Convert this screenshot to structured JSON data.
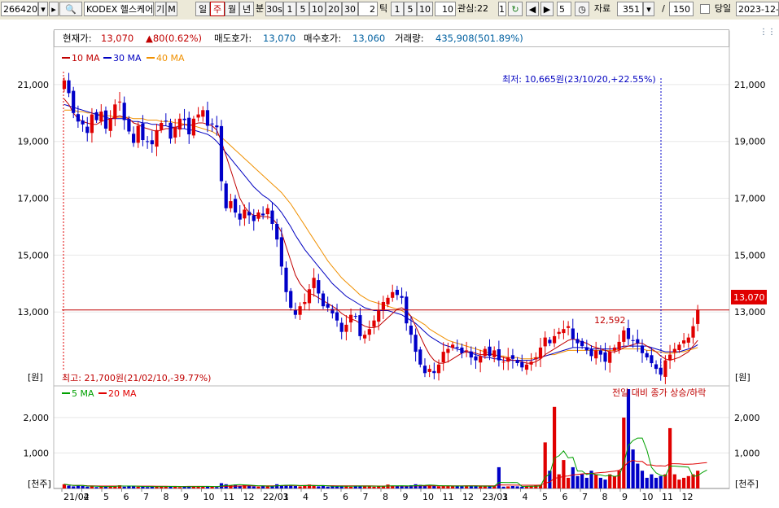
{
  "toolbar": {
    "code": "266420",
    "name": "KODEX 헬스케어",
    "btn_gi": "기",
    "btn_m": "M",
    "period_day": "일",
    "period_week": "주",
    "period_month": "월",
    "period_year": "년",
    "period_min": "분",
    "p30s": "30s",
    "p1": "1",
    "p5": "5",
    "p10": "10",
    "p20": "20",
    "p30": "30",
    "tick_value": "2",
    "tick_label": "틱",
    "t1": "1",
    "t5": "5",
    "t10": "10",
    "t10b": "10",
    "interest_label": "관심:22",
    "interest_num": "1",
    "step_value": "5",
    "data_label": "자료",
    "data_count": "351",
    "slash": "/",
    "view_count": "150",
    "today_label": "당일",
    "date": "2023-12-2"
  },
  "infobar": {
    "price_label": "현재가:",
    "price": "13,070",
    "change": "▲80(0.62%)",
    "ask_label": "매도호가:",
    "ask": "13,070",
    "bid_label": "매수호가:",
    "bid": "13,060",
    "volume_label": "거래량:",
    "volume": "435,908(501.89%)"
  },
  "labels": {
    "unit_price_left": "[원]",
    "unit_price_right": "[원]",
    "unit_vol_left": "[천주]",
    "unit_vol_right": "[천주]",
    "vol_note": "전일 대비 종가 상승/하락",
    "annot_low": "최저: 10,665원(23/10/20,+22.55%)",
    "annot_high": "최고: 21,700원(21/02/10,-39.77%)",
    "annot_mid": "12,592",
    "current_tag": "13,070"
  },
  "colors": {
    "up": "#e00000",
    "down": "#0000c8",
    "ma10": "#c00000",
    "ma30": "#0000c0",
    "ma40": "#f09000",
    "vma5": "#00a000",
    "vma20": "#e00000",
    "current_line": "#c00000",
    "grid": "#e8e8e8"
  },
  "chart_data": [
    {
      "type": "candlestick",
      "title": "",
      "legend": [
        "10 MA",
        "30 MA",
        "40 MA"
      ],
      "y_ticks": [
        "21,000",
        "19,000",
        "17,000",
        "15,000",
        "13,000"
      ],
      "ylim": [
        10400,
        22200
      ],
      "current": 13070,
      "x_ticks": [
        "21/02",
        "4",
        "5",
        "6",
        "7",
        "8",
        "9",
        "10",
        "11",
        "12",
        "22/01",
        "3",
        "4",
        "5",
        "6",
        "7",
        "8",
        "9",
        "10",
        "11",
        "12",
        "23/01",
        "3",
        "4",
        "5",
        "6",
        "7",
        "8",
        "9",
        "10",
        "11",
        "12"
      ],
      "closes": [
        21150,
        20700,
        20000,
        19700,
        19600,
        19300,
        19950,
        19750,
        20050,
        19450,
        19800,
        20300,
        20400,
        19750,
        19350,
        18950,
        19550,
        19050,
        19000,
        18900,
        19400,
        19650,
        19700,
        19100,
        19500,
        19800,
        19750,
        19250,
        19800,
        19950,
        20100,
        19550,
        19600,
        19500,
        17600,
        16650,
        16900,
        16500,
        16250,
        16600,
        16400,
        16200,
        16500,
        16400,
        16650,
        16100,
        15550,
        14600,
        13700,
        13150,
        12900,
        13200,
        13350,
        13800,
        14200,
        13650,
        13200,
        13150,
        12950,
        12700,
        12300,
        12550,
        12900,
        12850,
        12150,
        12200,
        12400,
        12700,
        13050,
        13350,
        13500,
        13700,
        13600,
        13500,
        12600,
        12200,
        11600,
        11150,
        10850,
        11000,
        10850,
        11150,
        11600,
        11700,
        11850,
        11750,
        11550,
        11650,
        11400,
        11300,
        11450,
        11700,
        11450,
        11650,
        11300,
        11250,
        11400,
        11350,
        11200,
        11050,
        11150,
        11250,
        11400,
        11750,
        12100,
        11900,
        12150,
        12300,
        12400,
        12500,
        12050,
        11900,
        11800,
        11650,
        11450,
        11650,
        11500,
        11250,
        11600,
        11750,
        11950,
        12350,
        12050,
        12000,
        11900,
        11550,
        11400,
        11200,
        11000,
        10800,
        11300,
        11500,
        11700,
        11850,
        12000,
        12100,
        12500,
        13070
      ],
      "ma10": [
        20500,
        20300,
        20000,
        19800,
        19700,
        19650,
        19600,
        19600,
        19700,
        19750,
        19800,
        19850,
        19900,
        19850,
        19800,
        19650,
        19600,
        19500,
        19450,
        19400,
        19350,
        19400,
        19450,
        19450,
        19500,
        19550,
        19600,
        19550,
        19600,
        19650,
        19650,
        19600,
        19550,
        19400,
        19000,
        18500,
        18000,
        17500,
        17000,
        16700,
        16500,
        16400,
        16400,
        16350,
        16350,
        16300,
        16100,
        15800,
        15300,
        14800,
        14300,
        14000,
        13800,
        13650,
        13600,
        13500,
        13400,
        13300,
        13200,
        13100,
        12950,
        12850,
        12750,
        12700,
        12600,
        12500,
        12450,
        12450,
        12500,
        12650,
        12800,
        12950,
        13100,
        13150,
        13050,
        12850,
        12500,
        12150,
        11800,
        11500,
        11300,
        11200,
        11200,
        11250,
        11350,
        11450,
        11550,
        11600,
        11600,
        11550,
        11500,
        11500,
        11500,
        11500,
        11450,
        11400,
        11350,
        11300,
        11300,
        11250,
        11200,
        11200,
        11250,
        11350,
        11500,
        11600,
        11700,
        11800,
        11900,
        12000,
        12050,
        12000,
        11950,
        11900,
        11800,
        11750,
        11700,
        11650,
        11600,
        11600,
        11650,
        11750,
        11800,
        11850,
        11900,
        11900,
        11800,
        11700,
        11600,
        11450,
        11350,
        11300,
        11350,
        11400,
        11500,
        11600,
        11800,
        12000
      ],
      "ma30": [
        20300,
        20250,
        20200,
        20150,
        20100,
        20050,
        20000,
        19950,
        19900,
        19850,
        19800,
        19800,
        19800,
        19800,
        19750,
        19700,
        19700,
        19650,
        19650,
        19600,
        19600,
        19550,
        19550,
        19500,
        19500,
        19450,
        19450,
        19400,
        19400,
        19350,
        19300,
        19250,
        19150,
        19000,
        18800,
        18600,
        18400,
        18200,
        18000,
        17800,
        17600,
        17400,
        17250,
        17100,
        17000,
        16850,
        16700,
        16500,
        16250,
        16000,
        15700,
        15450,
        15200,
        15000,
        14800,
        14600,
        14400,
        14200,
        14000,
        13850,
        13700,
        13550,
        13450,
        13350,
        13250,
        13150,
        13100,
        13050,
        13050,
        13050,
        13050,
        13000,
        12950,
        12900,
        12800,
        12700,
        12600,
        12450,
        12300,
        12150,
        12050,
        11950,
        11850,
        11800,
        11750,
        11700,
        11650,
        11600,
        11550,
        11500,
        11450,
        11400,
        11400,
        11350,
        11350,
        11300,
        11300,
        11300,
        11300,
        11300,
        11300,
        11300,
        11350,
        11400,
        11450,
        11500,
        11550,
        11600,
        11650,
        11700,
        11750,
        11750,
        11750,
        11750,
        11700,
        11700,
        11700,
        11700,
        11700,
        11700,
        11750,
        11800,
        11800,
        11800,
        11800,
        11800,
        11800,
        11750,
        11700,
        11650,
        11600,
        11600,
        11600,
        11600,
        11650,
        11700,
        11750,
        11850
      ],
      "ma40": [
        20100,
        20100,
        20100,
        20050,
        20050,
        20000,
        20000,
        19950,
        19950,
        19900,
        19900,
        19850,
        19850,
        19850,
        19850,
        19800,
        19800,
        19800,
        19750,
        19750,
        19750,
        19700,
        19700,
        19700,
        19650,
        19650,
        19600,
        19600,
        19550,
        19500,
        19450,
        19400,
        19350,
        19250,
        19150,
        19000,
        18850,
        18700,
        18550,
        18400,
        18250,
        18100,
        17950,
        17800,
        17650,
        17500,
        17350,
        17200,
        17000,
        16800,
        16550,
        16300,
        16050,
        15800,
        15550,
        15300,
        15050,
        14800,
        14600,
        14400,
        14200,
        14050,
        13900,
        13750,
        13600,
        13500,
        13400,
        13350,
        13300,
        13250,
        13200,
        13150,
        13100,
        13050,
        12950,
        12850,
        12750,
        12650,
        12550,
        12400,
        12300,
        12200,
        12100,
        12000,
        11950,
        11900,
        11850,
        11800,
        11750,
        11700,
        11650,
        11600,
        11550,
        11500,
        11450,
        11450,
        11400,
        11400,
        11400,
        11350,
        11350,
        11350,
        11400,
        11400,
        11450,
        11500,
        11500,
        11550,
        11600,
        11650,
        11650,
        11650,
        11650,
        11650,
        11650,
        11650,
        11650,
        11650,
        11650,
        11650,
        11700,
        11700,
        11700,
        11700,
        11700,
        11700,
        11650,
        11650,
        11600,
        11600,
        11550,
        11550,
        11550,
        11600,
        11600,
        11650,
        11700,
        11750
      ]
    },
    {
      "type": "bar",
      "title": "",
      "legend": [
        "5 MA",
        "20 MA"
      ],
      "y_ticks": [
        "2,000",
        "1,000"
      ],
      "ylim": [
        0,
        2800
      ],
      "volume_thousands": [
        120,
        80,
        60,
        90,
        70,
        50,
        60,
        40,
        50,
        70,
        60,
        80,
        90,
        50,
        60,
        70,
        50,
        60,
        40,
        60,
        50,
        70,
        60,
        50,
        60,
        40,
        50,
        60,
        70,
        60,
        50,
        60,
        50,
        40,
        150,
        120,
        90,
        110,
        80,
        100,
        90,
        60,
        50,
        70,
        60,
        80,
        120,
        90,
        100,
        80,
        70,
        60,
        90,
        110,
        80,
        60,
        70,
        50,
        60,
        70,
        80,
        60,
        50,
        70,
        80,
        70,
        60,
        50,
        60,
        70,
        110,
        80,
        60,
        70,
        60,
        90,
        120,
        100,
        80,
        90,
        70,
        60,
        80,
        70,
        60,
        70,
        60,
        80,
        70,
        60,
        60,
        70,
        60,
        70,
        600,
        50,
        60,
        70,
        60,
        50,
        60,
        70,
        80,
        100,
        1300,
        500,
        2300,
        400,
        800,
        300,
        600,
        350,
        400,
        300,
        500,
        400,
        300,
        250,
        400,
        350,
        500,
        2000,
        2800,
        1100,
        700,
        500,
        300,
        400,
        300,
        350,
        400,
        1700,
        400,
        250,
        300,
        350,
        400,
        500,
        700,
        650
      ]
    }
  ]
}
